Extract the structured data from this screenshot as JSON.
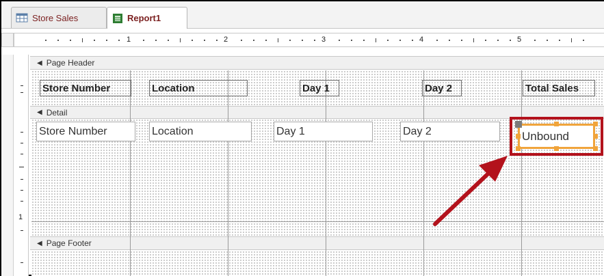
{
  "tabs": [
    {
      "label": "Store Sales",
      "icon": "table-icon",
      "active": false
    },
    {
      "label": "Report1",
      "icon": "report-icon",
      "active": true
    }
  ],
  "ruler": {
    "numbers": [
      "1",
      "2",
      "3",
      "4",
      "5"
    ],
    "vertical_number": "1"
  },
  "sections": {
    "page_header": "Page Header",
    "detail": "Detail",
    "page_footer": "Page Footer"
  },
  "header_labels": [
    "Store Number",
    "Location",
    "Day 1",
    "Day 2",
    "Total Sales"
  ],
  "detail_fields": [
    "Store Number",
    "Location",
    "Day 1",
    "Day 2"
  ],
  "unbound_control": "Unbound",
  "colors": {
    "highlight": "#b3121c",
    "selection": "#f0a43b",
    "tab_text": "#7a1f1f"
  }
}
